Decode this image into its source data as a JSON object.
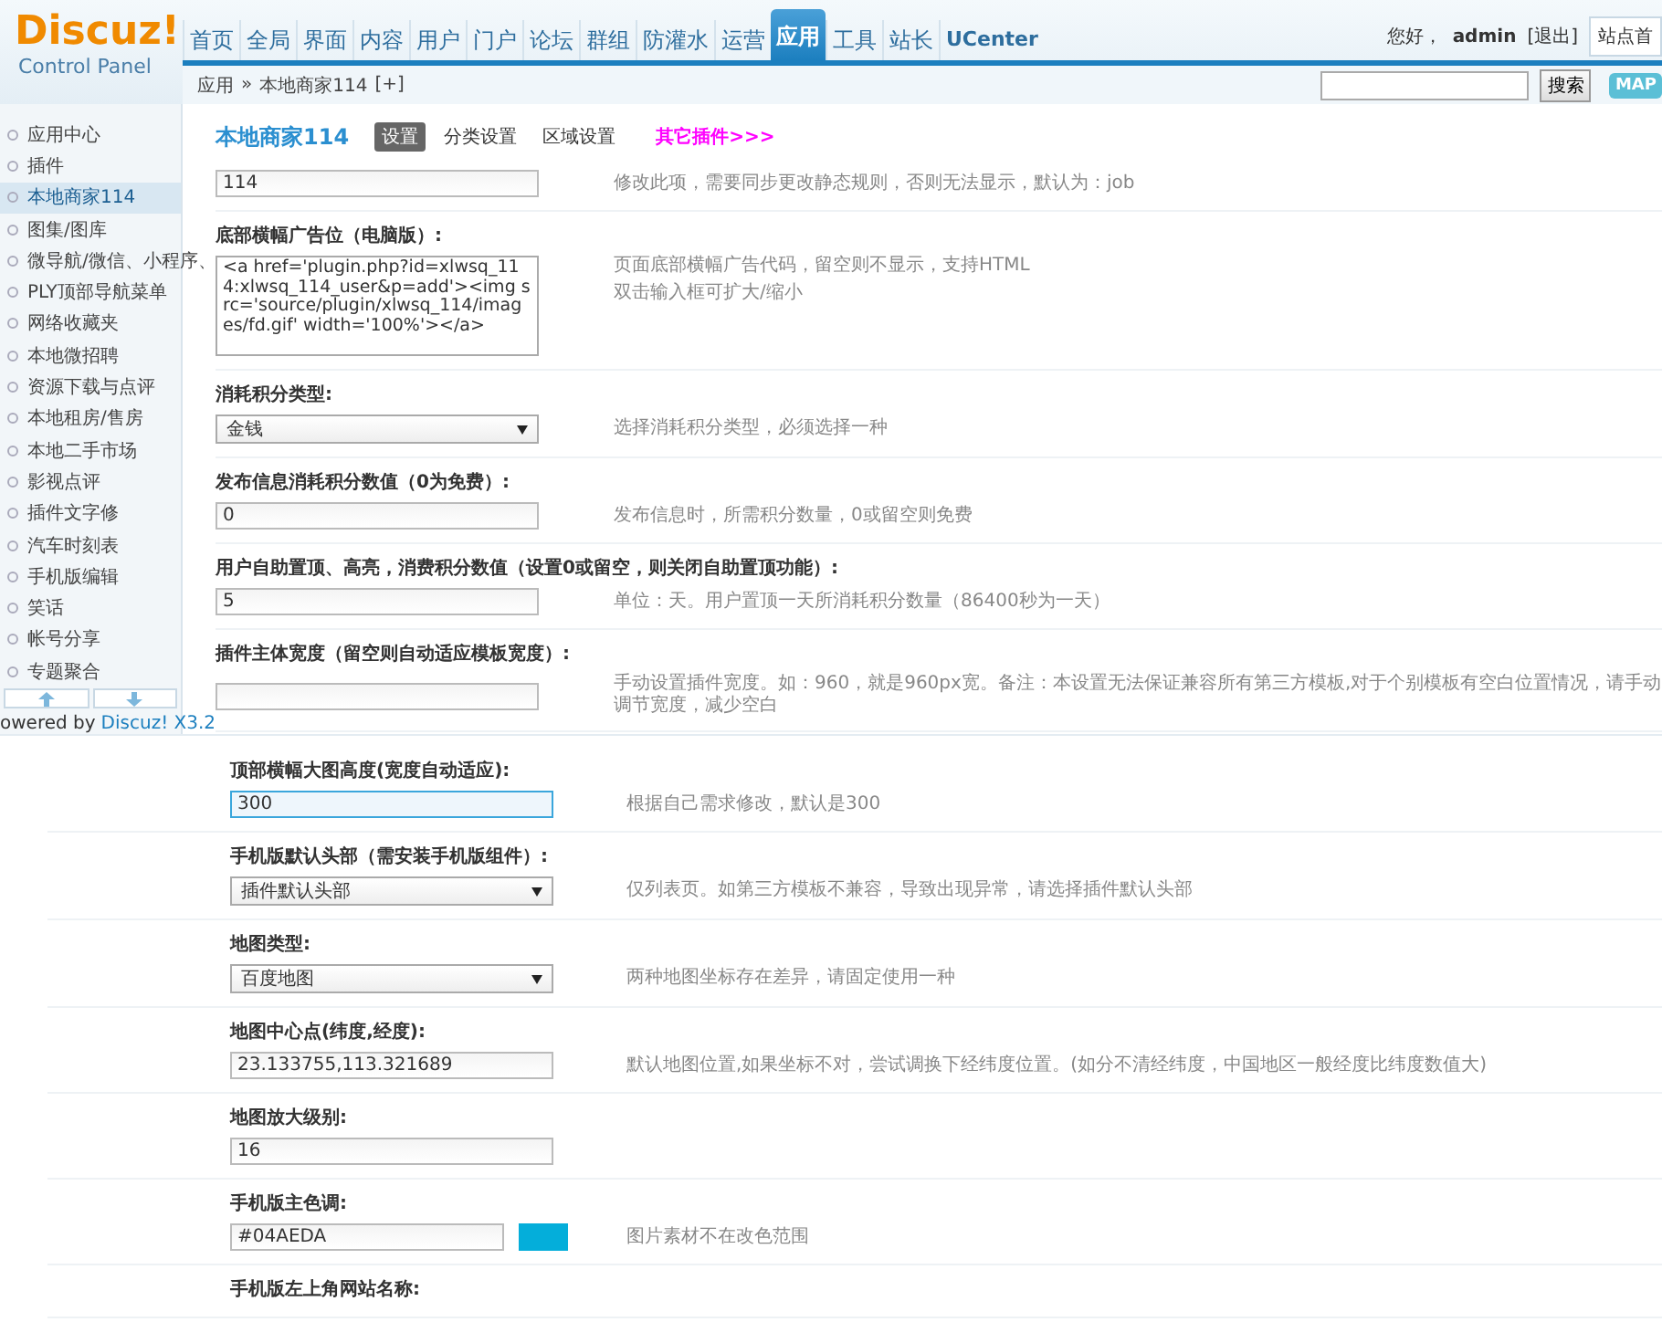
{
  "header": {
    "logo": "Discuz!",
    "logo_subtitle": "Control Panel",
    "nav": [
      {
        "label": "首页",
        "selected": false
      },
      {
        "label": "全局",
        "selected": false
      },
      {
        "label": "界面",
        "selected": false
      },
      {
        "label": "内容",
        "selected": false
      },
      {
        "label": "用户",
        "selected": false
      },
      {
        "label": "门户",
        "selected": false
      },
      {
        "label": "论坛",
        "selected": false
      },
      {
        "label": "群组",
        "selected": false
      },
      {
        "label": "防灌水",
        "selected": false
      },
      {
        "label": "运营",
        "selected": false
      },
      {
        "label": "应用",
        "selected": true
      },
      {
        "label": "工具",
        "selected": false
      },
      {
        "label": "站长",
        "selected": false
      },
      {
        "label": "UCenter",
        "selected": false
      }
    ],
    "greeting": "您好，",
    "user": "admin",
    "logout": "[退出]",
    "site_home": "站点首"
  },
  "breadcrumb": {
    "path": [
      "应用",
      "本地商家114"
    ],
    "separator": "»",
    "add": "[+]"
  },
  "search": {
    "button": "搜索",
    "map_button": "MAP"
  },
  "sidebar": {
    "items": [
      {
        "label": "应用中心",
        "selected": false
      },
      {
        "label": "插件",
        "selected": false
      },
      {
        "label": "本地商家114",
        "selected": true
      },
      {
        "label": "图集/图库",
        "selected": false
      },
      {
        "label": "微导航/微信、小程序、",
        "selected": false
      },
      {
        "label": "PLY顶部导航菜单",
        "selected": false
      },
      {
        "label": "网络收藏夹",
        "selected": false
      },
      {
        "label": "本地微招聘",
        "selected": false
      },
      {
        "label": "资源下载与点评",
        "selected": false
      },
      {
        "label": "本地租房/售房",
        "selected": false
      },
      {
        "label": "本地二手市场",
        "selected": false
      },
      {
        "label": "影视点评",
        "selected": false
      },
      {
        "label": "插件文字修",
        "selected": false
      },
      {
        "label": "汽车时刻表",
        "selected": false
      },
      {
        "label": "手机版编辑",
        "selected": false
      },
      {
        "label": "笑话",
        "selected": false
      },
      {
        "label": "帐号分享",
        "selected": false
      },
      {
        "label": "专题聚合",
        "selected": false
      }
    ],
    "footer_prefix": "owered by",
    "footer_link": "Discuz! X3.2"
  },
  "plugin": {
    "title": "本地商家114",
    "tabs": [
      {
        "label": "设置",
        "selected": true
      },
      {
        "label": "分类设置",
        "selected": false
      },
      {
        "label": "区域设置",
        "selected": false
      }
    ],
    "more_link": "其它插件>>>"
  },
  "settings": [
    {
      "control": {
        "kind": "text",
        "value": "114"
      },
      "description": [
        "修改此项，需要同步更改静态规则，否则无法显示，默认为：job"
      ]
    },
    {
      "label": "底部横幅广告位（电脑版）:",
      "control": {
        "kind": "textarea",
        "value": "<a href='plugin.php?id=xlwsq_114:xlwsq_114_user&p=add'><img src='source/plugin/xlwsq_114/images/fd.gif' width='100%'></a>"
      },
      "description": [
        "页面底部横幅广告代码，留空则不显示，支持HTML",
        "双击输入框可扩大/缩小"
      ]
    },
    {
      "label": "消耗积分类型:",
      "control": {
        "kind": "select",
        "value": "金钱"
      },
      "description": [
        "选择消耗积分类型，必须选择一种"
      ]
    },
    {
      "label": "发布信息消耗积分数值（0为免费）:",
      "control": {
        "kind": "text",
        "value": "0"
      },
      "description": [
        "发布信息时，所需积分数量，0或留空则免费"
      ]
    },
    {
      "label": "用户自助置顶、高亮，消费积分数值（设置0或留空，则关闭自助置顶功能）:",
      "control": {
        "kind": "text",
        "value": "5"
      },
      "description": [
        "单位：天。用户置顶一天所消耗积分数量（86400秒为一天）"
      ]
    },
    {
      "label": "插件主体宽度（留空则自动适应模板宽度）:",
      "control": {
        "kind": "text"
      },
      "description": [
        "手动设置插件宽度。如：960，就是960px宽。备注：本设置无法保证兼容所有第三方模板,对于个别模板有空白位置情况，请手动调节宽度，减少空白"
      ]
    }
  ],
  "second_capture": {
    "settings": [
      {
        "label": "顶部横幅大图高度(宽度自动适应):",
        "control": {
          "kind": "text",
          "value": "300",
          "focused": true
        },
        "description": [
          "根据自己需求修改，默认是300"
        ]
      },
      {
        "label": "手机版默认头部（需安装手机版组件）:",
        "control": {
          "kind": "select",
          "value": "插件默认头部",
          "focused": false
        },
        "description": [
          "仅列表页。如第三方模板不兼容，导致出现异常，请选择插件默认头部"
        ]
      },
      {
        "label": "地图类型:",
        "control": {
          "kind": "select",
          "value": "百度地图",
          "focused": false
        },
        "description": [
          "两种地图坐标存在差异，请固定使用一种"
        ]
      },
      {
        "label": "地图中心点(纬度,经度):",
        "control": {
          "kind": "text",
          "value": "23.133755,113.321689",
          "focused": false
        },
        "description": [
          "默认地图位置,如果坐标不对，尝试调换下经纬度位置。(如分不清经纬度，中国地区一般经度比纬度数值大)"
        ]
      },
      {
        "label": "地图放大级别:",
        "control": {
          "kind": "text",
          "value": "16",
          "focused": false
        }
      },
      {
        "label": "手机版主色调:",
        "control": {
          "kind": "color",
          "value": "#04AEDA",
          "color": "#04aeda",
          "focused": false
        },
        "description": [
          "图片素材不在改色范围"
        ]
      },
      {
        "label": "手机版左上角网站名称:"
      }
    ]
  }
}
